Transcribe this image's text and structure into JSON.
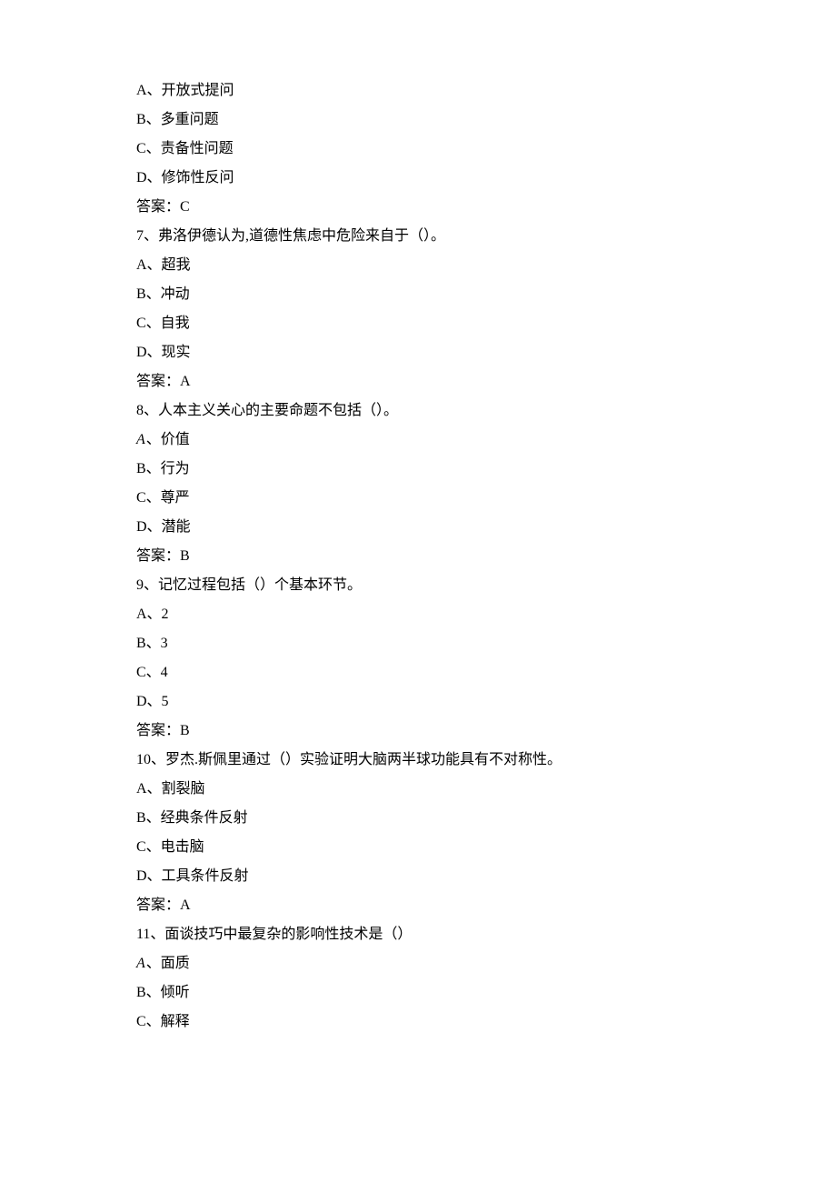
{
  "q6": {
    "options": [
      "A、开放式提问",
      "B、多重问题",
      "C、责备性问题",
      "D、修饰性反问"
    ],
    "answer": "答案：C"
  },
  "q7": {
    "stem": "7、弗洛伊德认为,道德性焦虑中危险来自于（）。",
    "options": [
      "A、超我",
      "B、冲动",
      "C、自我",
      "D、现实"
    ],
    "answer": "答案：A"
  },
  "q8": {
    "stem": "8、人本主义关心的主要命题不包括（）。",
    "optA_letter": "A",
    "optA_rest": "、价值",
    "options_rest": [
      "B、行为",
      "C、尊严",
      "D、潜能"
    ],
    "answer": "答案：B"
  },
  "q9": {
    "stem": "9、记忆过程包括（）个基本环节。",
    "options": [
      "A、2",
      "B、3",
      "C、4",
      "D、5"
    ],
    "answer": "答案：B"
  },
  "q10": {
    "stem": "10、罗杰.斯佩里通过（）实验证明大脑两半球功能具有不对称性。",
    "options": [
      "A、割裂脑",
      "B、经典条件反射",
      "C、电击脑",
      "D、工具条件反射"
    ],
    "answer": "答案：A"
  },
  "q11": {
    "stem": "11、面谈技巧中最复杂的影响性技术是（）",
    "optA_letter": "A",
    "optA_rest": "、面质",
    "options_rest": [
      "B、倾听",
      "C、解释"
    ]
  }
}
